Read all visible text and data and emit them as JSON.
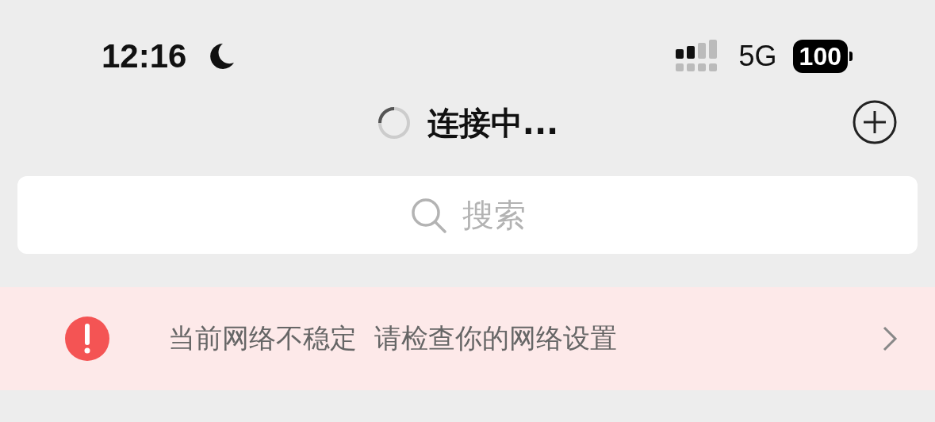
{
  "status_bar": {
    "time": "12:16",
    "network": "5G",
    "battery": "100"
  },
  "nav_bar": {
    "title": "连接中..."
  },
  "search": {
    "placeholder": "搜索"
  },
  "banner": {
    "message": "当前网络不稳定  请检查你的网络设置"
  }
}
